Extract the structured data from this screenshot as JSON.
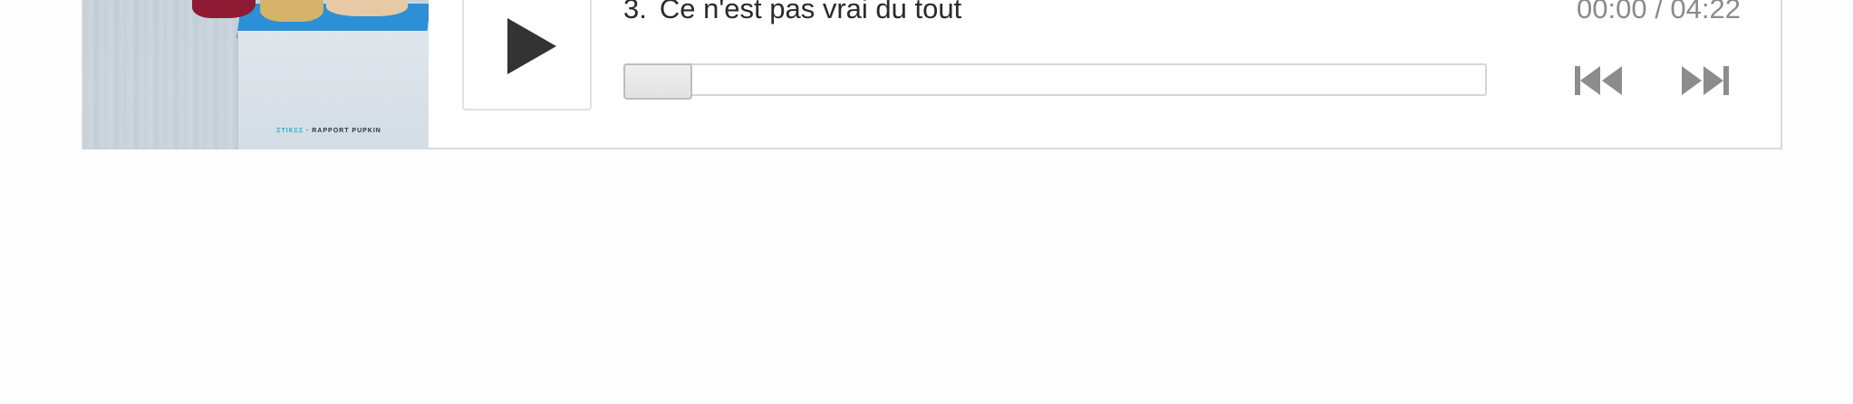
{
  "track": {
    "number": "3.",
    "title": "Ce n'est pas vrai du tout"
  },
  "time": {
    "current": "00:00",
    "separator": " / ",
    "duration": "04:22"
  },
  "progress": {
    "fraction": 0
  },
  "album_art": {
    "caption_accent": "ΞТIКΞΞ",
    "caption_separator": " · ",
    "caption_label": "RAPPORT PUPKIN"
  },
  "controls": {
    "play_icon": "play-icon",
    "prev_icon": "skip-back-icon",
    "next_icon": "skip-forward-icon"
  },
  "colors": {
    "icon_dark": "#333333",
    "icon_gray": "#8c8c8c",
    "border": "#dadada",
    "art_blue": "#2d8fd6"
  }
}
